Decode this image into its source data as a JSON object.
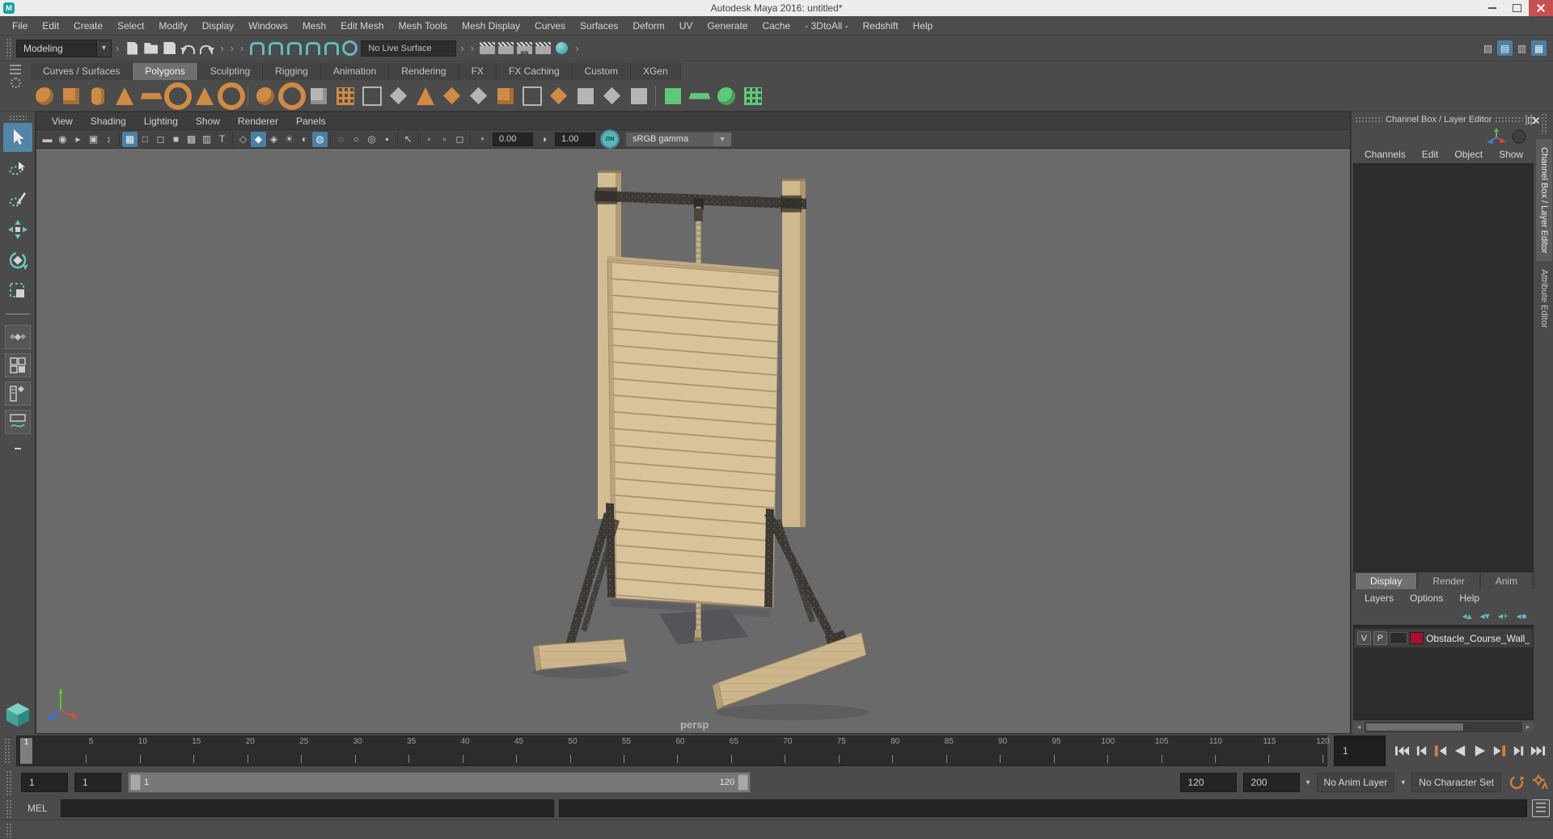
{
  "window": {
    "title": "Autodesk Maya 2016: untitled*"
  },
  "menubar": {
    "items": [
      "File",
      "Edit",
      "Create",
      "Select",
      "Modify",
      "Display",
      "Windows",
      "Mesh",
      "Edit Mesh",
      "Mesh Tools",
      "Mesh Display",
      "Curves",
      "Surfaces",
      "Deform",
      "UV",
      "Generate",
      "Cache",
      "- 3DtoAll -",
      "Redshift",
      "Help"
    ]
  },
  "statusline": {
    "mode": "Modeling",
    "live_surface": "No Live Surface",
    "ipr_label": "IPR",
    "file_buttons": [
      {
        "name": "new-scene",
        "glyph": "page"
      },
      {
        "name": "open-scene",
        "glyph": "folder"
      },
      {
        "name": "save-scene",
        "glyph": "floppy"
      },
      {
        "name": "undo",
        "glyph": "undo"
      },
      {
        "name": "redo",
        "glyph": "redo"
      }
    ],
    "snap_buttons": [
      {
        "name": "snap-to-grid",
        "glyph": "magnet"
      },
      {
        "name": "snap-to-curve",
        "glyph": "magnet"
      },
      {
        "name": "snap-to-point",
        "glyph": "magnet"
      },
      {
        "name": "snap-to-projected-center",
        "glyph": "magnet"
      },
      {
        "name": "snap-to-view-plane",
        "glyph": "magnet"
      },
      {
        "name": "make-live",
        "glyph": "live"
      }
    ],
    "render_buttons": [
      {
        "name": "open-render-view",
        "glyph": "clap"
      },
      {
        "name": "render-current-frame",
        "glyph": "clap"
      },
      {
        "name": "ipr-render",
        "glyph": "clap",
        "sub": "IPR"
      },
      {
        "name": "render-settings",
        "glyph": "clap"
      },
      {
        "name": "hypershade",
        "glyph": "ball"
      }
    ],
    "sidebar_buttons": [
      {
        "name": "modeling-toolkit",
        "char": "▧",
        "active": false
      },
      {
        "name": "attribute-editor",
        "char": "▤",
        "active": true
      },
      {
        "name": "tool-settings",
        "char": "▥",
        "active": false
      },
      {
        "name": "channel-box-toggle",
        "char": "▦",
        "active": true
      }
    ]
  },
  "shelf": {
    "tabs": [
      {
        "label": "Curves / Surfaces",
        "active": false
      },
      {
        "label": "Polygons",
        "active": true
      },
      {
        "label": "Sculpting",
        "active": false
      },
      {
        "label": "Rigging",
        "active": false
      },
      {
        "label": "Animation",
        "active": false
      },
      {
        "label": "Rendering",
        "active": false
      },
      {
        "label": "FX",
        "active": false
      },
      {
        "label": "FX Caching",
        "active": false
      },
      {
        "label": "Custom",
        "active": false
      },
      {
        "label": "XGen",
        "active": false
      }
    ],
    "icons": [
      {
        "name": "poly-sphere",
        "glyph": "sphere",
        "tone": "orange"
      },
      {
        "name": "poly-cube",
        "glyph": "cube",
        "tone": "orange"
      },
      {
        "name": "poly-cylinder",
        "glyph": "cylinder",
        "tone": "orange"
      },
      {
        "name": "poly-cone",
        "glyph": "cone",
        "tone": "orange"
      },
      {
        "name": "poly-plane",
        "glyph": "plane",
        "tone": "orange"
      },
      {
        "name": "poly-torus",
        "glyph": "torus",
        "tone": "orange"
      },
      {
        "name": "poly-prism",
        "glyph": "cone",
        "tone": "orange"
      },
      {
        "name": "poly-pipe",
        "glyph": "torus",
        "tone": "orange"
      },
      {
        "sep": true
      },
      {
        "name": "smooth",
        "glyph": "sphere",
        "tone": "orange"
      },
      {
        "name": "add-divisions",
        "glyph": "torus",
        "tone": "orange"
      },
      {
        "name": "boolean",
        "glyph": "cube",
        "tone": "gray"
      },
      {
        "name": "quadrangulate",
        "glyph": "grid",
        "tone": "orange"
      },
      {
        "name": "mesh-cleanup",
        "glyph": "square-outline",
        "tone": "gray"
      },
      {
        "name": "multi-cut",
        "glyph": "diamond",
        "tone": "gray"
      },
      {
        "name": "connect",
        "glyph": "cone",
        "tone": "orange"
      },
      {
        "name": "bevel",
        "glyph": "diamond",
        "tone": "orange"
      },
      {
        "name": "bridge",
        "glyph": "diamond",
        "tone": "gray"
      },
      {
        "name": "extrude",
        "glyph": "cube",
        "tone": "orange"
      },
      {
        "name": "merge-vertices",
        "glyph": "square-outline",
        "tone": "gray"
      },
      {
        "name": "target-weld",
        "glyph": "diamond",
        "tone": "orange"
      },
      {
        "name": "edge-flow",
        "glyph": "square",
        "tone": "gray"
      },
      {
        "name": "crease-tool",
        "glyph": "diamond",
        "tone": "gray"
      },
      {
        "name": "symmetrize",
        "glyph": "square",
        "tone": "gray"
      },
      {
        "sep": true
      },
      {
        "name": "quad-draw",
        "glyph": "square",
        "tone": "green"
      },
      {
        "name": "sculpt-mesh",
        "glyph": "plane",
        "tone": "green"
      },
      {
        "name": "relax-brush",
        "glyph": "sphere",
        "tone": "green"
      },
      {
        "name": "paint-transfer",
        "glyph": "grid",
        "tone": "green"
      }
    ]
  },
  "panel_menus": [
    "View",
    "Shading",
    "Lighting",
    "Show",
    "Renderer",
    "Panels"
  ],
  "viewport_bar": {
    "exposure": "0.00",
    "gamma": "1.00",
    "on_badge": "ON",
    "color_transform": "sRGB gamma",
    "icons": [
      {
        "name": "select-camera",
        "char": "▬"
      },
      {
        "name": "camera-attributes",
        "char": "◉"
      },
      {
        "name": "bookmark",
        "char": "▸"
      },
      {
        "name": "image-plane",
        "char": "▣"
      },
      {
        "name": "two-d-pan-zoom",
        "char": "↕"
      },
      {
        "sep": true
      },
      {
        "name": "grid-toggle",
        "char": "▦",
        "active": true
      },
      {
        "name": "film-gate",
        "char": "□"
      },
      {
        "name": "resolution-gate",
        "char": "◻"
      },
      {
        "name": "gate-mask",
        "char": "■"
      },
      {
        "name": "field-chart",
        "char": "▩"
      },
      {
        "name": "safe-action",
        "char": "▥"
      },
      {
        "name": "safe-title",
        "char": "T"
      },
      {
        "sep": true
      },
      {
        "name": "wireframe-mode",
        "char": "◇"
      },
      {
        "name": "shaded-mode",
        "char": "◆",
        "active": true
      },
      {
        "name": "textured-mode",
        "char": "◈"
      },
      {
        "name": "use-all-lights",
        "char": "☀"
      },
      {
        "name": "shadows",
        "char": "◐"
      },
      {
        "name": "screen-space-ao",
        "char": "◍",
        "active": true
      },
      {
        "sep": true
      },
      {
        "name": "motion-blur",
        "char": "◌"
      },
      {
        "name": "multisample-aa",
        "char": "○"
      },
      {
        "name": "depth-of-field",
        "char": "◎"
      },
      {
        "name": "frame-buffer",
        "char": "▪"
      },
      {
        "sep": true
      },
      {
        "name": "isolate-select",
        "char": "↖"
      },
      {
        "sep": true
      },
      {
        "name": "xray",
        "char": "▫"
      },
      {
        "name": "xray-joints",
        "char": "▫"
      },
      {
        "name": "xray-active-components",
        "char": "◻"
      },
      {
        "sep": true
      }
    ]
  },
  "viewport": {
    "camera": "persp"
  },
  "channel_box": {
    "title": "Channel Box / Layer Editor",
    "menus": [
      "Channels",
      "Edit",
      "Object",
      "Show"
    ]
  },
  "side_tabs": [
    {
      "label": "Channel Box / Layer Editor",
      "active": true
    },
    {
      "label": "Attribute Editor",
      "active": false
    }
  ],
  "layer_editor": {
    "tabs": [
      {
        "label": "Display",
        "active": true
      },
      {
        "label": "Render",
        "active": false
      },
      {
        "label": "Anim",
        "active": false
      }
    ],
    "menus": [
      "Layers",
      "Options",
      "Help"
    ],
    "move_icons": [
      {
        "name": "layer-move-up",
        "char": "◂▴"
      },
      {
        "name": "layer-move-down",
        "char": "◂▾"
      },
      {
        "name": "create-empty-layer",
        "char": "◂+"
      },
      {
        "name": "create-layer-from-selected",
        "char": "◂●"
      }
    ],
    "layers": [
      {
        "v": "V",
        "p": "P",
        "name": "Obstacle_Course_Wall_w",
        "color": "#a8102e"
      }
    ]
  },
  "timeline": {
    "current_frame": "1",
    "ticks": [
      5,
      10,
      15,
      20,
      25,
      30,
      35,
      40,
      45,
      50,
      55,
      60,
      65,
      70,
      75,
      80,
      85,
      90,
      95,
      100,
      105,
      110,
      115,
      120
    ]
  },
  "range_bar": {
    "anim_start": "1",
    "playback_start": "1",
    "slider_start": "1",
    "slider_end": "120",
    "playback_end": "120",
    "anim_end": "200",
    "anim_layer": "No Anim Layer",
    "character_set": "No Character Set"
  },
  "command_line": {
    "label": "MEL"
  },
  "colors": {
    "accent_teal": "#5fbcbc",
    "accent_orange": "#d2813b",
    "selection_blue": "#5285a6",
    "layer_swatch": "#a8102e",
    "viewport_bg": "#6a6a6a"
  }
}
